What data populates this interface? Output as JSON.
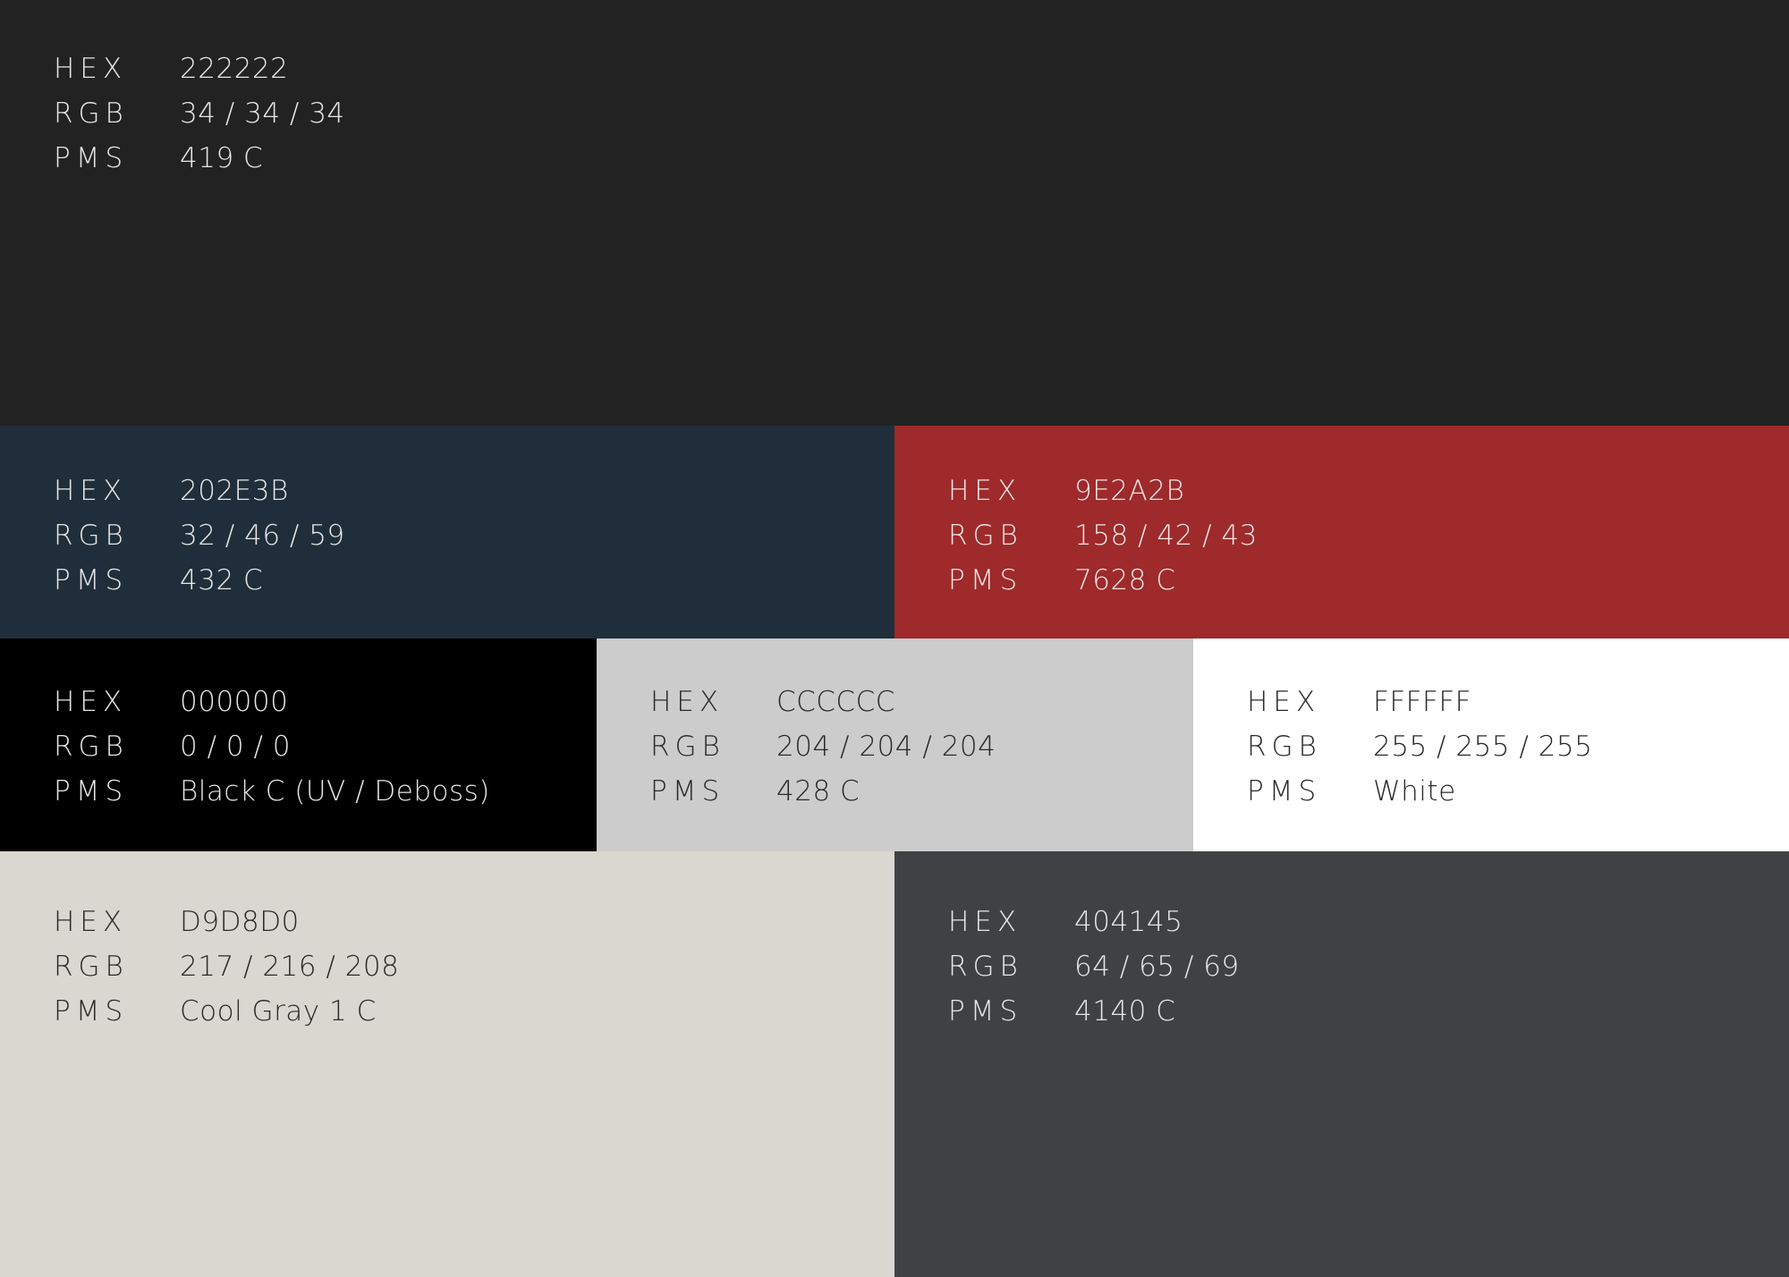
{
  "labels": {
    "hex": "HEX",
    "rgb": "RGB",
    "pms": "PMS"
  },
  "swatches": [
    {
      "hex": "222222",
      "rgb": "34 / 34 / 34",
      "pms": "419 C",
      "bg": "#222222",
      "fg": "#e6e6e6"
    },
    {
      "hex": "202E3B",
      "rgb": "32 / 46 / 59",
      "pms": "432 C",
      "bg": "#202e3b",
      "fg": "#e6e6e6"
    },
    {
      "hex": "9E2A2B",
      "rgb": "158 / 42 / 43",
      "pms": "7628 C",
      "bg": "#9e2a2b",
      "fg": "#f0e4e4"
    },
    {
      "hex": "000000",
      "rgb": "0 / 0 / 0",
      "pms": "Black C (UV / Deboss)",
      "bg": "#000000",
      "fg": "#e6e6e6"
    },
    {
      "hex": "CCCCCC",
      "rgb": "204 / 204 / 204",
      "pms": "428 C",
      "bg": "#cccccc",
      "fg": "#2a2a2a"
    },
    {
      "hex": "FFFFFF",
      "rgb": "255 / 255 / 255",
      "pms": "White",
      "bg": "#ffffff",
      "fg": "#2a2a2a"
    },
    {
      "hex": "D9D8D0",
      "rgb": "217 / 216 / 208",
      "pms": "Cool Gray 1 C",
      "bg": "#d9d8d0",
      "fg": "#2a2a2a"
    },
    {
      "hex": "404145",
      "rgb": "64 / 65 / 69",
      "pms": "4140 C",
      "bg": "#404145",
      "fg": "#e6e6e6"
    }
  ]
}
